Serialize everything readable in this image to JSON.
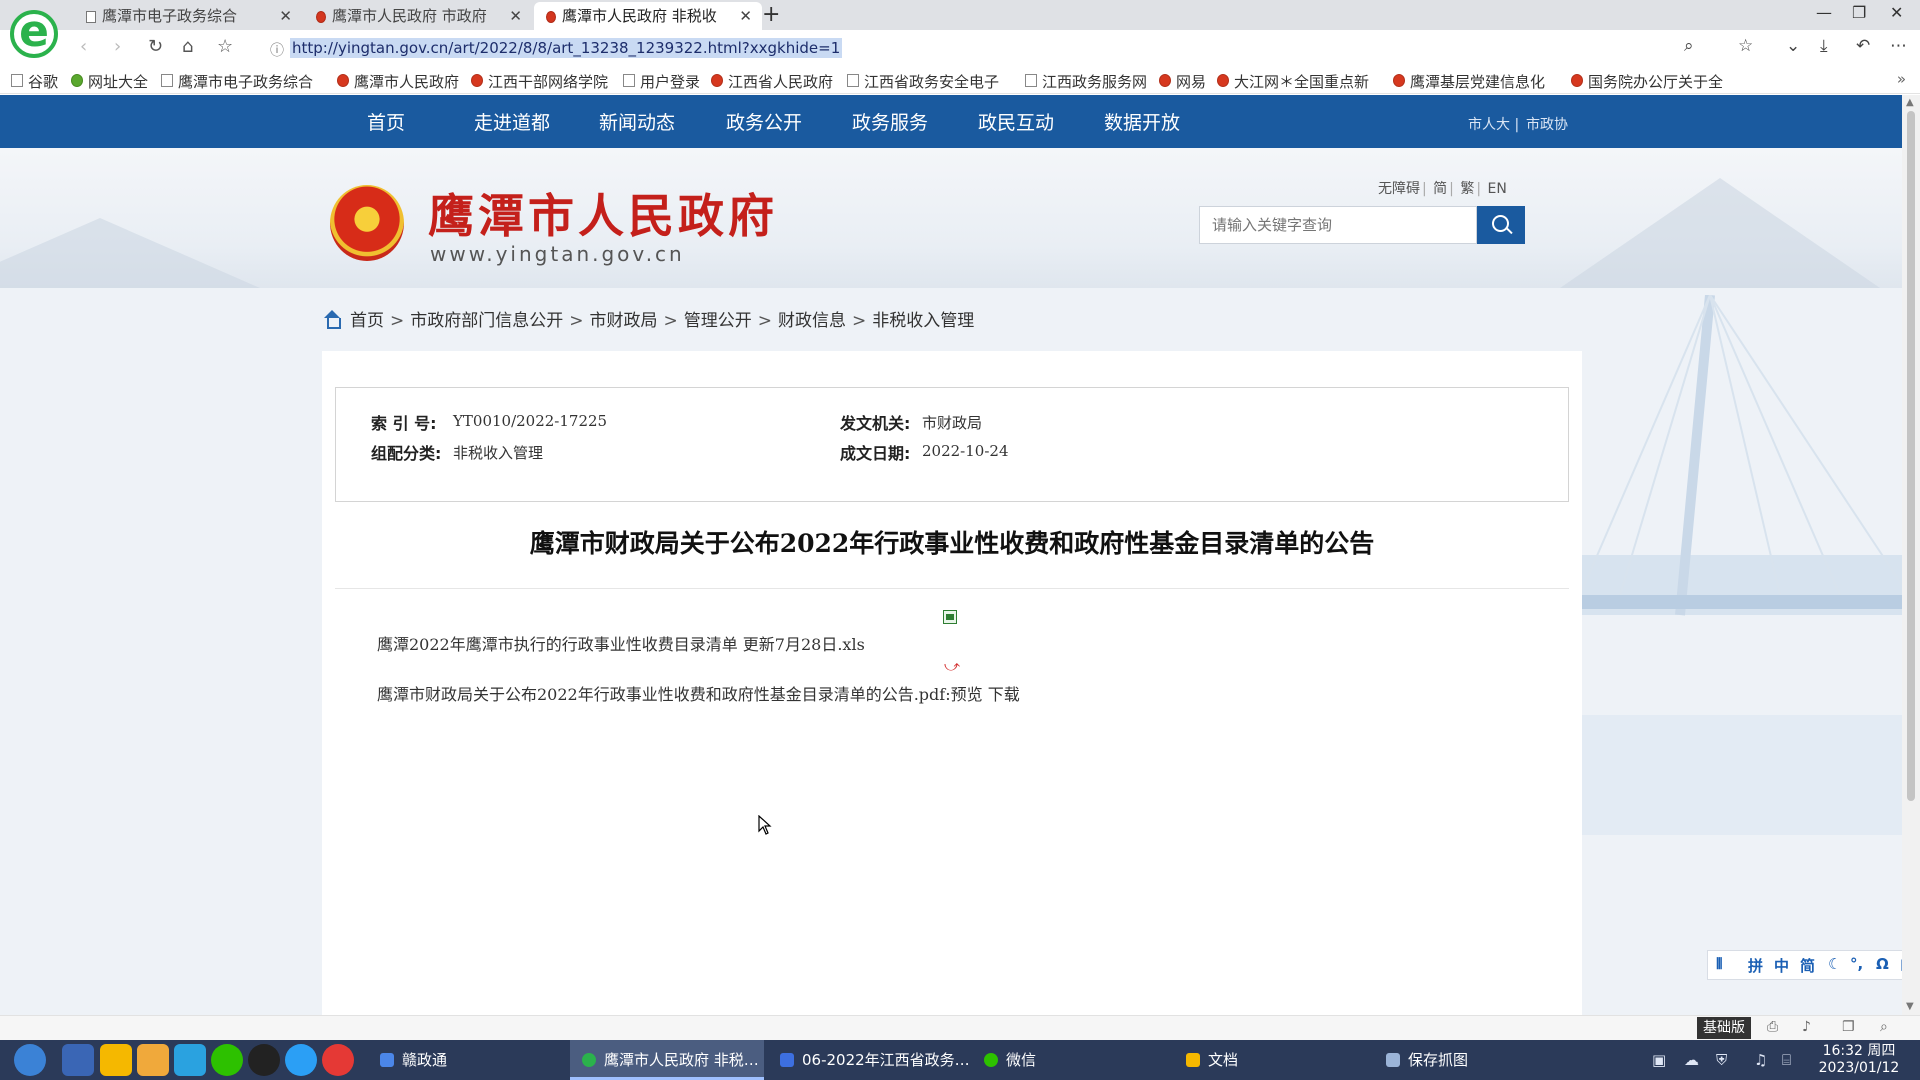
{
  "browser": {
    "tabs": [
      {
        "title": "鹰潭市电子政务综合",
        "active": false
      },
      {
        "title": "鹰潭市人民政府 市政府",
        "active": false
      },
      {
        "title": "鹰潭市人民政府 非税收",
        "active": true
      }
    ],
    "url": "http://yingtan.gov.cn/art/2022/8/8/art_13238_1239322.html?xxgkhide=1",
    "bookmarks": [
      "谷歌",
      "网址大全",
      "鹰潭市电子政务综合",
      "鹰潭市人民政府",
      "江西干部网络学院",
      "用户登录",
      "江西省人民政府",
      "江西省政务安全电子",
      "江西政务服务网",
      "网易",
      "大江网＊全国重点新",
      "鹰潭基层党建信息化",
      "国务院办公厅关于全"
    ],
    "bookmarks_more": "»"
  },
  "site": {
    "nav": [
      "首页",
      "走进道都",
      "新闻动态",
      "政务公开",
      "政务服务",
      "政民互动",
      "数据开放"
    ],
    "nav_right": [
      "市人大",
      "市政协"
    ],
    "title": "鹰潭市人民政府",
    "domain": "www.yingtan.gov.cn",
    "access_links": [
      "无障碍",
      "简",
      "繁",
      "EN"
    ],
    "search_placeholder": "请输入关键字查询",
    "breadcrumb": [
      "首页",
      "市政府部门信息公开",
      "市财政局",
      "管理公开",
      "财政信息",
      "非税收入管理"
    ]
  },
  "article": {
    "meta": {
      "index_label": "索 引 号:",
      "index_value": "YT0010/2022-17225",
      "issuer_label": "发文机关:",
      "issuer_value": "市财政局",
      "category_label": "组配分类:",
      "category_value": "非税收入管理",
      "date_label": "成文日期:",
      "date_value": "2022-10-24"
    },
    "title": "鹰潭市财政局关于公布2022年行政事业性收费和政府性基金目录清单的公告",
    "attachments": [
      {
        "name": "鹰潭2022年鹰潭市执行的行政事业性收费目录清单 更新7月28日.xls",
        "icon": "excel-icon"
      },
      {
        "name": "鹰潭市财政局关于公布2022年行政事业性收费和政府性基金目录清单的公告.pdf:",
        "preview": "预览",
        "download": "下载",
        "icon": "pdf-icon"
      }
    ]
  },
  "ime": [
    "拼",
    "中",
    "简"
  ],
  "statusbar": {
    "mode": "基础版"
  },
  "taskbar": {
    "tasks": [
      {
        "label": "赣政通",
        "active": false
      },
      {
        "label": "鹰潭市人民政府 非税…",
        "active": true
      },
      {
        "label": "06-2022年江西省政务…",
        "active": false
      },
      {
        "label": "微信",
        "active": false
      },
      {
        "label": "文档",
        "active": false
      },
      {
        "label": "保存抓图",
        "active": false
      }
    ],
    "time": "16:32 周四",
    "date": "2023/01/12"
  },
  "colors": {
    "nav_blue": "#1a5a9f",
    "title_red": "#c4201b"
  }
}
